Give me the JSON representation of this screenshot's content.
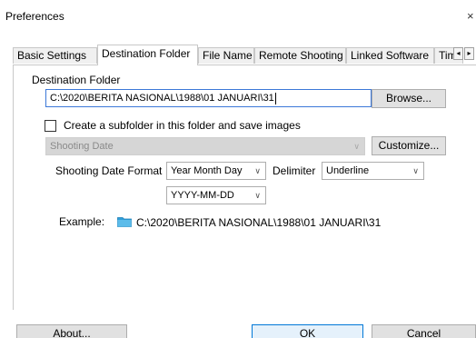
{
  "window": {
    "title": "Preferences",
    "close_glyph": "×"
  },
  "tabs": [
    {
      "label": "Basic Settings",
      "active": false
    },
    {
      "label": "Destination Folder",
      "active": true
    },
    {
      "label": "File Name",
      "active": false
    },
    {
      "label": "Remote Shooting",
      "active": false
    },
    {
      "label": "Linked Software",
      "active": false
    },
    {
      "label": "Tim",
      "active": false
    }
  ],
  "tab_scroll": {
    "left": "◂",
    "right": "▸"
  },
  "destination": {
    "label": "Destination Folder",
    "value": "C:\\2020\\BERITA NASIONAL\\1988\\01 JANUARI\\31",
    "browse_label": "Browse..."
  },
  "subfolder": {
    "checkbox_label": "Create a subfolder in this folder and save images",
    "checked": false,
    "mode_value": "Shooting Date",
    "customize_label": "Customize..."
  },
  "date_format": {
    "label": "Shooting Date Format",
    "order_value": "Year Month Day",
    "delimiter_label": "Delimiter",
    "delimiter_value": "Underline",
    "pattern_value": "YYYY-MM-DD"
  },
  "example": {
    "label": "Example:",
    "icon": "folder-icon",
    "path": "C:\\2020\\BERITA NASIONAL\\1988\\01 JANUARI\\31"
  },
  "footer": {
    "about_label": "About...",
    "ok_label": "OK",
    "cancel_label": "Cancel"
  },
  "colors": {
    "accent": "#0078d7",
    "folder": "#2f9ed8"
  }
}
